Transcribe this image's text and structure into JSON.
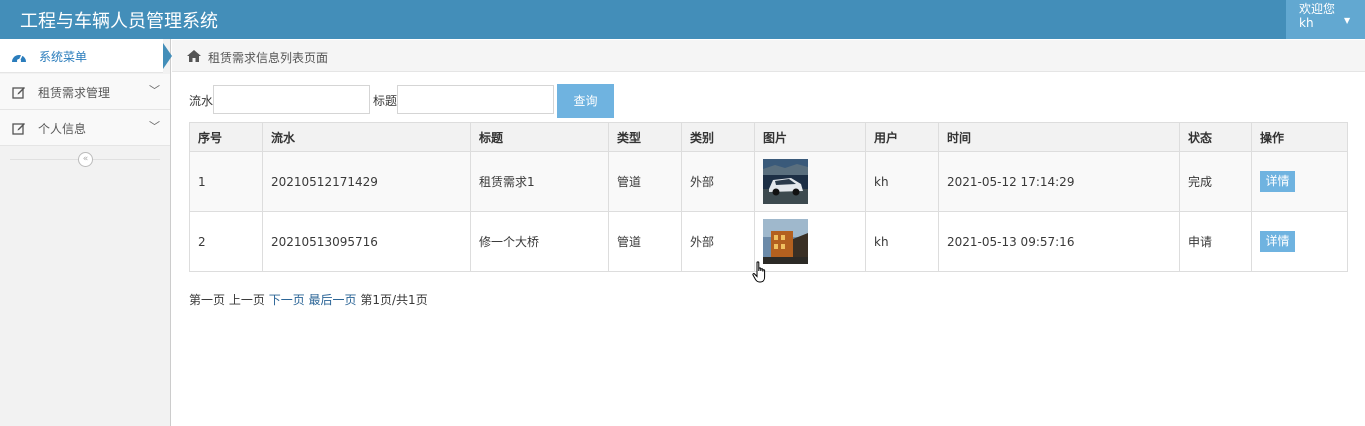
{
  "app": {
    "title": "工程与车辆人员管理系统"
  },
  "user": {
    "greeting": "欢迎您",
    "name": "kh"
  },
  "sidebar": {
    "header": {
      "label": "系统菜单",
      "icon": "dashboard-icon"
    },
    "items": [
      {
        "label": "租赁需求管理",
        "icon": "edit-icon"
      },
      {
        "label": "个人信息",
        "icon": "edit-icon"
      }
    ],
    "collapse_icon": "double-left-icon"
  },
  "breadcrumb": {
    "icon": "home-icon",
    "text": "租赁需求信息列表页面"
  },
  "search": {
    "serial_label": "流水",
    "serial_value": "",
    "title_label": "标题",
    "title_value": "",
    "button_label": "查询"
  },
  "table": {
    "columns": [
      "序号",
      "流水",
      "标题",
      "类型",
      "类别",
      "图片",
      "用户",
      "时间",
      "状态",
      "操作"
    ],
    "rows": [
      {
        "index": "1",
        "serial": "20210512171429",
        "title": "租赁需求1",
        "type": "管道",
        "category": "外部",
        "image": "car-photo",
        "user": "kh",
        "time": "2021-05-12 17:14:29",
        "status": "完成",
        "action": "详情"
      },
      {
        "index": "2",
        "serial": "20210513095716",
        "title": "修一个大桥",
        "type": "管道",
        "category": "外部",
        "image": "building-photo",
        "user": "kh",
        "time": "2021-05-13 09:57:16",
        "status": "申请",
        "action": "详情"
      }
    ]
  },
  "pager": {
    "first": "第一页",
    "prev": "上一页",
    "next": "下一页",
    "last": "最后一页",
    "info": "第1页/共1页"
  },
  "colors": {
    "navbar": "#438eb9",
    "accent": "#6fb3e0",
    "link": "#2a6496"
  }
}
